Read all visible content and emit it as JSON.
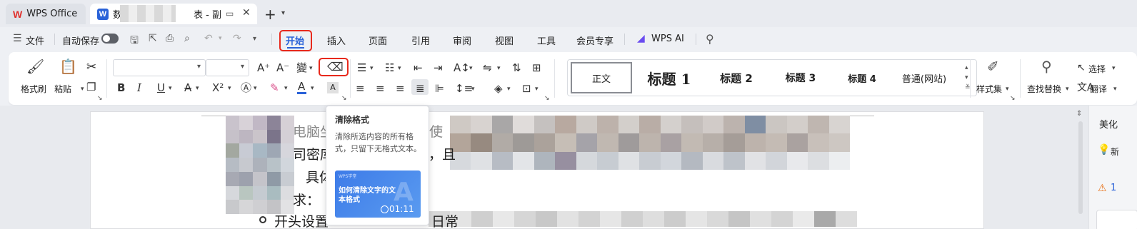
{
  "tabs": {
    "home_label": "WPS Office",
    "doc_title_suffix": "表 - 副",
    "doc_title_prefix": "数"
  },
  "menu": {
    "file": "文件",
    "autosave": "自动保存",
    "items": [
      "开始",
      "插入",
      "页面",
      "引用",
      "审阅",
      "视图",
      "工具",
      "会员专享"
    ],
    "wps_ai": "WPS AI",
    "active": "开始"
  },
  "ribbon": {
    "format_painter": "格式刷",
    "paste": "粘贴",
    "font_name": "",
    "font_size": "",
    "styles": [
      "正文",
      "标题 1",
      "标题 2",
      "标题 3",
      "标题 4",
      "普通(网站)"
    ],
    "style_set": "样式集",
    "find_replace": "查找替换",
    "select": "选择",
    "translate": "翻译"
  },
  "tooltip": {
    "title": "清除格式",
    "description": "清除所选内容的所有格式，只留下无格式文本。",
    "video_brand": "WPS学堂",
    "video_title": "如何清除文字的文本格式",
    "video_duration": "01:11"
  },
  "document": {
    "lines": [
      "电脑坐",
      "么使",
      "司密库",
      "，且",
      "具体",
      "求：",
      "开头设置",
      "日常"
    ]
  },
  "right_panel": {
    "title": "美化",
    "new_label": "新",
    "warning_count": "1"
  },
  "colors": {
    "accent": "#2a62d8",
    "highlight": "#e8291c",
    "ribbon_bg": "#ffffff"
  }
}
